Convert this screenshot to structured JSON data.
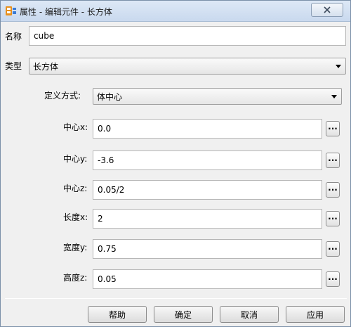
{
  "window": {
    "title": "属性 - 编辑元件 - 长方体"
  },
  "form": {
    "name_label": "名称",
    "name_value": "cube",
    "type_label": "类型",
    "type_value": "长方体",
    "define_label": "定义方式:",
    "define_value": "体中心",
    "rows": [
      {
        "label": "中心x:",
        "value": "0.0"
      },
      {
        "label": "中心y:",
        "value": "-3.6"
      },
      {
        "label": "中心z:",
        "value": "0.05/2"
      },
      {
        "label": "长度x:",
        "value": "2"
      },
      {
        "label": "宽度y:",
        "value": "0.75"
      },
      {
        "label": "高度z:",
        "value": "0.05"
      }
    ],
    "ellipsis_label": "..."
  },
  "buttons": {
    "help": "帮助",
    "ok": "确定",
    "cancel": "取消",
    "apply": "应用"
  },
  "colors": {
    "titlebar": "#c9d9ee",
    "dialog_bg": "#f0f0f0",
    "icon_orange": "#e8901c"
  }
}
